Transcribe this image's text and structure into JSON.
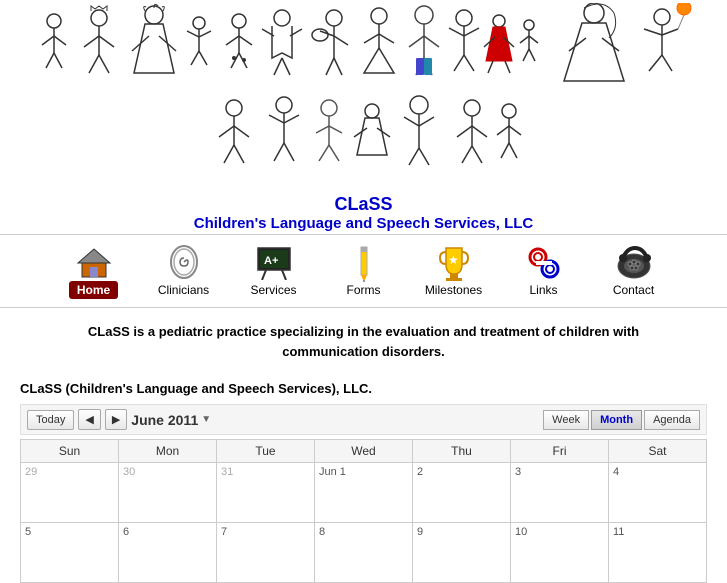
{
  "site": {
    "name": "CLaSS",
    "subtitle": "Children's Language and Speech Services, LLC"
  },
  "nav": {
    "items": [
      {
        "id": "home",
        "label": "Home",
        "active": true
      },
      {
        "id": "clinicians",
        "label": "Clinicians",
        "active": false
      },
      {
        "id": "services",
        "label": "Services",
        "active": false
      },
      {
        "id": "forms",
        "label": "Forms",
        "active": false
      },
      {
        "id": "milestones",
        "label": "Milestones",
        "active": false
      },
      {
        "id": "links",
        "label": "Links",
        "active": false
      },
      {
        "id": "contact",
        "label": "Contact",
        "active": false
      }
    ]
  },
  "description": "CLaSS is a pediatric practice specializing in the evaluation and treatment of children with communication disorders.",
  "calendar": {
    "title": "CLaSS (Children's Language and Speech Services), LLC.",
    "today_label": "Today",
    "current_month": "June 2011",
    "view_buttons": [
      {
        "id": "week",
        "label": "Week"
      },
      {
        "id": "month",
        "label": "Month",
        "active": true
      },
      {
        "id": "agenda",
        "label": "Agenda"
      }
    ],
    "weekdays": [
      "Sun",
      "Mon",
      "Tue",
      "Wed",
      "Thu",
      "Fri",
      "Sat"
    ],
    "rows": [
      [
        {
          "day": "29",
          "other": true
        },
        {
          "day": "30",
          "other": true
        },
        {
          "day": "31",
          "other": true
        },
        {
          "day": "Jun 1",
          "first": true
        },
        {
          "day": "2"
        },
        {
          "day": "3"
        },
        {
          "day": "4"
        }
      ],
      [
        {
          "day": "5"
        },
        {
          "day": "6"
        },
        {
          "day": "7"
        },
        {
          "day": "8"
        },
        {
          "day": "9"
        },
        {
          "day": "10"
        },
        {
          "day": "11"
        }
      ]
    ]
  }
}
